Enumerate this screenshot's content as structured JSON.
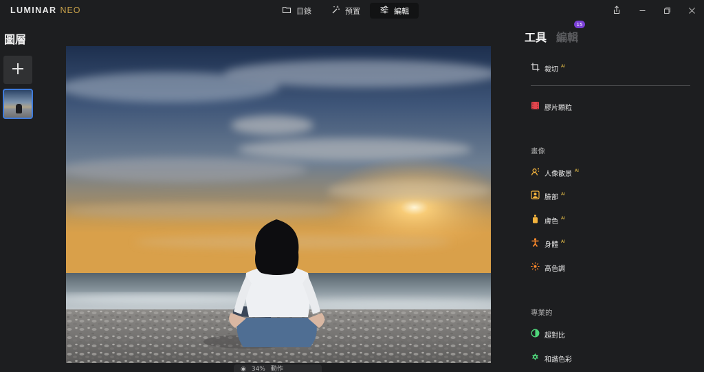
{
  "app": {
    "logo_main": "LUMINAR",
    "logo_sub": "NEO"
  },
  "topbar": {
    "tabs": [
      {
        "label": "目錄",
        "icon": "folder-icon"
      },
      {
        "label": "預置",
        "icon": "magic-wand-icon"
      },
      {
        "label": "編輯",
        "icon": "sliders-icon"
      }
    ]
  },
  "left": {
    "title": "圖層"
  },
  "right": {
    "tab_tools": "工具",
    "tab_edits": "編輯",
    "edits_badge": "15",
    "tools": [
      {
        "label": "裁切",
        "ai": "AI",
        "icon": "crop-icon"
      },
      {
        "label": "膠片顆粒",
        "ai": "",
        "icon": "film-grain-icon"
      }
    ],
    "section_portrait": "畫像",
    "portrait_tools": [
      {
        "label": "人像散景",
        "ai": "AI",
        "icon": "portrait-bokeh-icon"
      },
      {
        "label": "臉部",
        "ai": "AI",
        "icon": "face-icon"
      },
      {
        "label": "膚色",
        "ai": "AI",
        "icon": "skin-icon"
      },
      {
        "label": "身體",
        "ai": "AI",
        "icon": "body-icon"
      },
      {
        "label": "高色調",
        "ai": "",
        "icon": "high-key-icon"
      }
    ],
    "section_pro": "專業的",
    "pro_tools": [
      {
        "label": "超對比",
        "ai": "",
        "icon": "supercontrast-icon"
      },
      {
        "label": "和諧色彩",
        "ai": "",
        "icon": "color-harmony-icon"
      }
    ]
  },
  "bottom": {
    "zoom": "34%",
    "action": "動作"
  },
  "colors": {
    "accent": "#3e7bdc",
    "badge": "#7a3fd6",
    "ai_label": "#f0c64a",
    "portrait_icon": "#f3b33d",
    "body_icon": "#ff8a2b",
    "pro_icon": "#4fd67a"
  }
}
